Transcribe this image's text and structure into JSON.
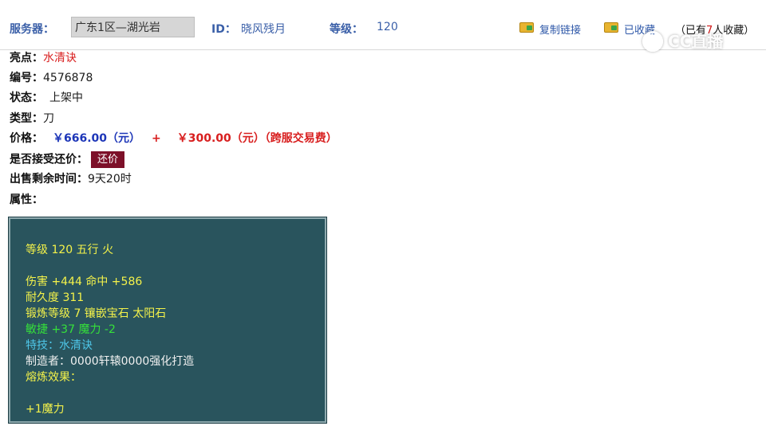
{
  "header": {
    "server_label": "服务器：",
    "server_value": "广东1区—湖光岩",
    "id_label": "ID：",
    "id_value": "晓风残月",
    "level_label": "等级：",
    "level_value": "120",
    "copy_link": "复制链接",
    "favorited": "已收藏",
    "fav_prefix": "（已有",
    "fav_count": "7",
    "fav_suffix": "人收藏）",
    "watermark": "CC直播"
  },
  "details": {
    "highlight_label": "亮点：",
    "highlight_value": "水清诀",
    "number_label": "编号：",
    "number_value": "4576878",
    "status_label": "状态：",
    "status_value": "上架中",
    "type_label": "类型：",
    "type_value": "刀",
    "price_label": "价格：",
    "price_value": "￥666.00（元）",
    "price_plus": "+",
    "fee_value": "￥300.00（元）（跨服交易费）",
    "counter_label": "是否接受还价：",
    "counter_button": "还价",
    "remaining_label": "出售剩余时间：",
    "remaining_value": "9天20时",
    "attr_label": "属性："
  },
  "attributes": [
    {
      "text": "等级 120 五行 火",
      "color": "#f4f24a"
    },
    {
      "text": "伤害 +444 命中 +586",
      "color": "#f4f24a"
    },
    {
      "text": "耐久度 311",
      "color": "#f4f24a"
    },
    {
      "text": "锻炼等级 7 镶嵌宝石 太阳石",
      "color": "#f4f24a"
    },
    {
      "text": "敏捷 +37 魔力 -2",
      "color": "#35e03a"
    },
    {
      "text": "特技：水清诀",
      "color": "#4ec6e8"
    },
    {
      "text": "制造者：0000轩辕0000强化打造",
      "color": "#f0f0f0"
    },
    {
      "text": "熔炼效果：",
      "color": "#f4f24a"
    },
    {
      "text": "+1魔力",
      "color": "#f4f24a"
    }
  ]
}
